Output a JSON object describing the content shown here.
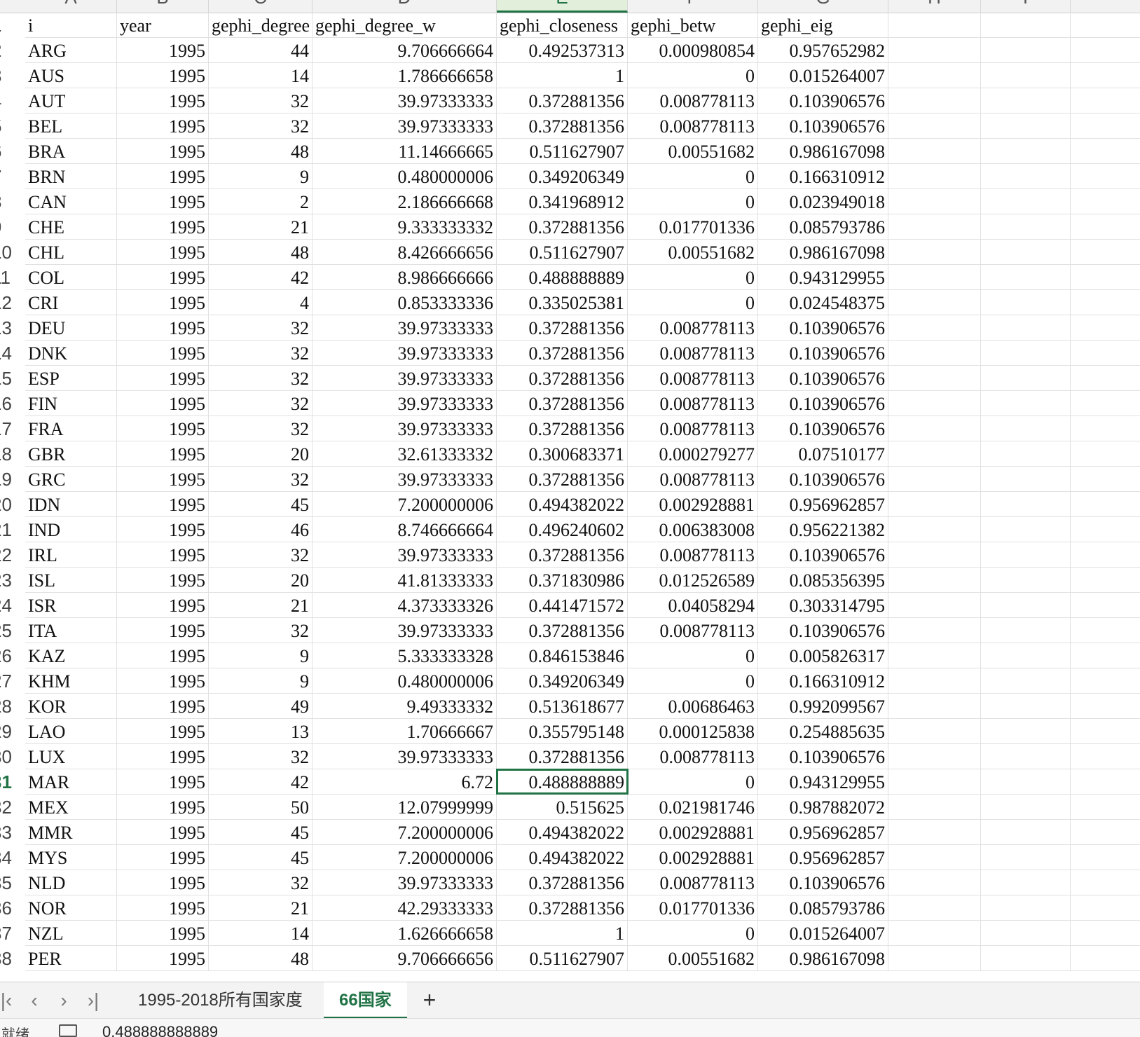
{
  "columns": [
    {
      "letter": "A",
      "selected": false
    },
    {
      "letter": "B",
      "selected": false
    },
    {
      "letter": "C",
      "selected": false
    },
    {
      "letter": "D",
      "selected": false
    },
    {
      "letter": "E",
      "selected": true
    },
    {
      "letter": "F",
      "selected": false
    },
    {
      "letter": "G",
      "selected": false
    },
    {
      "letter": "H",
      "selected": false
    },
    {
      "letter": "I",
      "selected": false
    }
  ],
  "header": [
    "i",
    "year",
    "gephi_degree",
    "gephi_degree_w",
    "gephi_closeness",
    "gephi_betw",
    "gephi_eig"
  ],
  "rows": [
    [
      "ARG",
      "1995",
      "44",
      "9.706666664",
      "0.492537313",
      "0.000980854",
      "0.957652982"
    ],
    [
      "AUS",
      "1995",
      "14",
      "1.786666658",
      "1",
      "0",
      "0.015264007"
    ],
    [
      "AUT",
      "1995",
      "32",
      "39.97333333",
      "0.372881356",
      "0.008778113",
      "0.103906576"
    ],
    [
      "BEL",
      "1995",
      "32",
      "39.97333333",
      "0.372881356",
      "0.008778113",
      "0.103906576"
    ],
    [
      "BRA",
      "1995",
      "48",
      "11.14666665",
      "0.511627907",
      "0.00551682",
      "0.986167098"
    ],
    [
      "BRN",
      "1995",
      "9",
      "0.480000006",
      "0.349206349",
      "0",
      "0.166310912"
    ],
    [
      "CAN",
      "1995",
      "2",
      "2.186666668",
      "0.341968912",
      "0",
      "0.023949018"
    ],
    [
      "CHE",
      "1995",
      "21",
      "9.333333332",
      "0.372881356",
      "0.017701336",
      "0.085793786"
    ],
    [
      "CHL",
      "1995",
      "48",
      "8.426666656",
      "0.511627907",
      "0.00551682",
      "0.986167098"
    ],
    [
      "COL",
      "1995",
      "42",
      "8.986666666",
      "0.488888889",
      "0",
      "0.943129955"
    ],
    [
      "CRI",
      "1995",
      "4",
      "0.853333336",
      "0.335025381",
      "0",
      "0.024548375"
    ],
    [
      "DEU",
      "1995",
      "32",
      "39.97333333",
      "0.372881356",
      "0.008778113",
      "0.103906576"
    ],
    [
      "DNK",
      "1995",
      "32",
      "39.97333333",
      "0.372881356",
      "0.008778113",
      "0.103906576"
    ],
    [
      "ESP",
      "1995",
      "32",
      "39.97333333",
      "0.372881356",
      "0.008778113",
      "0.103906576"
    ],
    [
      "FIN",
      "1995",
      "32",
      "39.97333333",
      "0.372881356",
      "0.008778113",
      "0.103906576"
    ],
    [
      "FRA",
      "1995",
      "32",
      "39.97333333",
      "0.372881356",
      "0.008778113",
      "0.103906576"
    ],
    [
      "GBR",
      "1995",
      "20",
      "32.61333332",
      "0.300683371",
      "0.000279277",
      "0.07510177"
    ],
    [
      "GRC",
      "1995",
      "32",
      "39.97333333",
      "0.372881356",
      "0.008778113",
      "0.103906576"
    ],
    [
      "IDN",
      "1995",
      "45",
      "7.200000006",
      "0.494382022",
      "0.002928881",
      "0.956962857"
    ],
    [
      "IND",
      "1995",
      "46",
      "8.746666664",
      "0.496240602",
      "0.006383008",
      "0.956221382"
    ],
    [
      "IRL",
      "1995",
      "32",
      "39.97333333",
      "0.372881356",
      "0.008778113",
      "0.103906576"
    ],
    [
      "ISL",
      "1995",
      "20",
      "41.81333333",
      "0.371830986",
      "0.012526589",
      "0.085356395"
    ],
    [
      "ISR",
      "1995",
      "21",
      "4.373333326",
      "0.441471572",
      "0.04058294",
      "0.303314795"
    ],
    [
      "ITA",
      "1995",
      "32",
      "39.97333333",
      "0.372881356",
      "0.008778113",
      "0.103906576"
    ],
    [
      "KAZ",
      "1995",
      "9",
      "5.333333328",
      "0.846153846",
      "0",
      "0.005826317"
    ],
    [
      "KHM",
      "1995",
      "9",
      "0.480000006",
      "0.349206349",
      "0",
      "0.166310912"
    ],
    [
      "KOR",
      "1995",
      "49",
      "9.49333332",
      "0.513618677",
      "0.00686463",
      "0.992099567"
    ],
    [
      "LAO",
      "1995",
      "13",
      "1.70666667",
      "0.355795148",
      "0.000125838",
      "0.254885635"
    ],
    [
      "LUX",
      "1995",
      "32",
      "39.97333333",
      "0.372881356",
      "0.008778113",
      "0.103906576"
    ],
    [
      "MAR",
      "1995",
      "42",
      "6.72",
      "0.488888889",
      "0",
      "0.943129955"
    ],
    [
      "MEX",
      "1995",
      "50",
      "12.07999999",
      "0.515625",
      "0.021981746",
      "0.987882072"
    ],
    [
      "MMR",
      "1995",
      "45",
      "7.200000006",
      "0.494382022",
      "0.002928881",
      "0.956962857"
    ],
    [
      "MYS",
      "1995",
      "45",
      "7.200000006",
      "0.494382022",
      "0.002928881",
      "0.956962857"
    ],
    [
      "NLD",
      "1995",
      "32",
      "39.97333333",
      "0.372881356",
      "0.008778113",
      "0.103906576"
    ],
    [
      "NOR",
      "1995",
      "21",
      "42.29333333",
      "0.372881356",
      "0.017701336",
      "0.085793786"
    ],
    [
      "NZL",
      "1995",
      "14",
      "1.626666658",
      "1",
      "0",
      "0.015264007"
    ],
    [
      "PER",
      "1995",
      "48",
      "9.706666656",
      "0.511627907",
      "0.00551682",
      "0.986167098"
    ]
  ],
  "active_cell": {
    "row": 31,
    "col": "E"
  },
  "tabs": {
    "items": [
      {
        "label": "1995-2018所有国家度",
        "active": false
      },
      {
        "label": "66国家",
        "active": true
      }
    ],
    "add_label": "+"
  },
  "status": {
    "label": "就绪",
    "cell_value": "0.488888888889"
  },
  "colors": {
    "accent": "#217346",
    "grid": "#e1e1e1",
    "header_bg": "#f2f2f2"
  }
}
